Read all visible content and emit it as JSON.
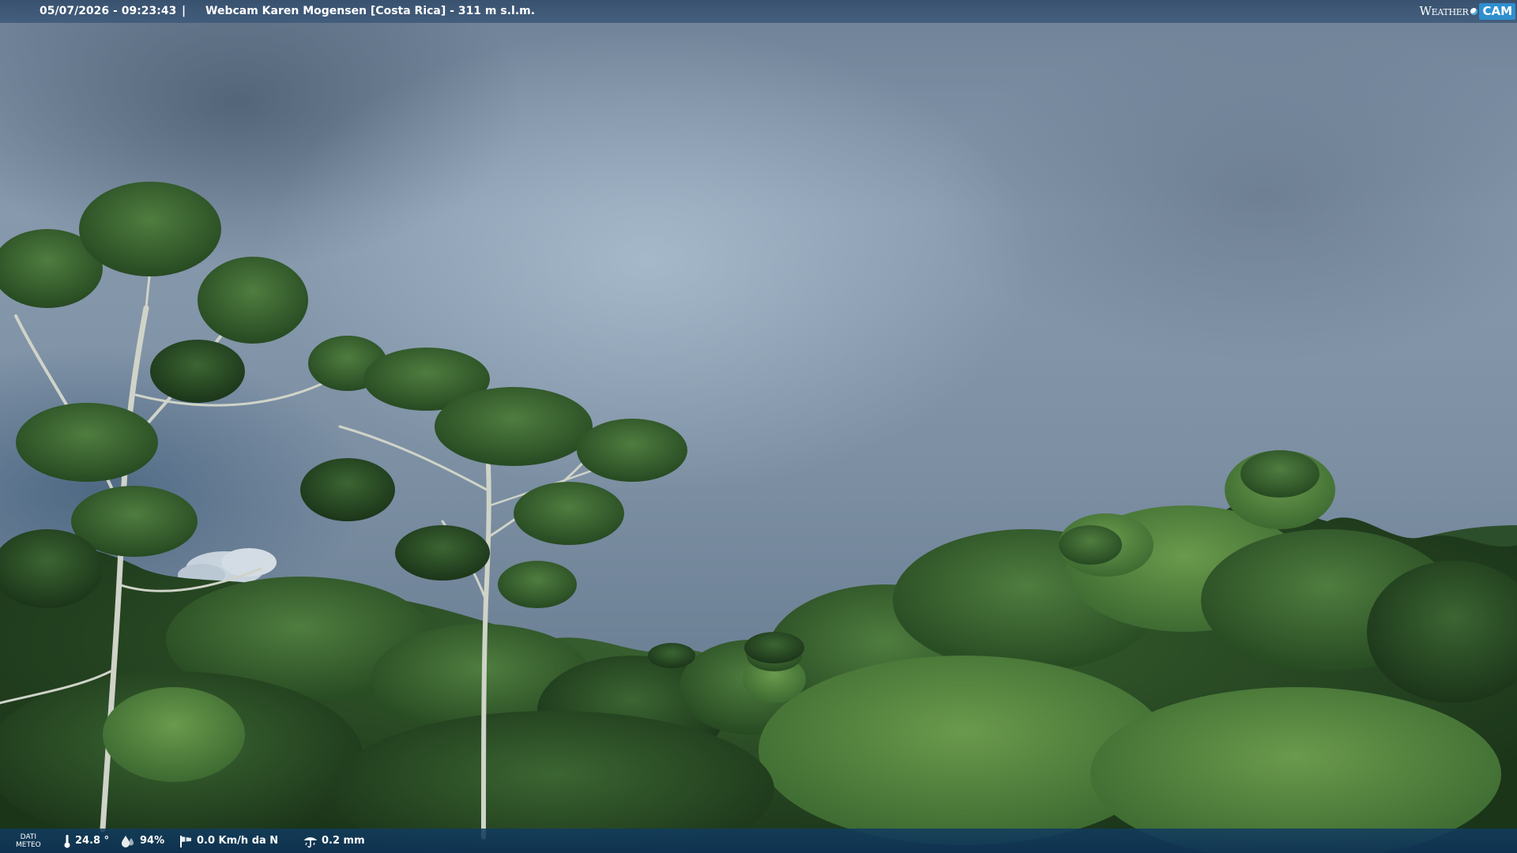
{
  "top_bar": {
    "timestamp": "05/07/2026 - 09:23:43",
    "separator": "|",
    "title": "Webcam Karen Mogensen [Costa Rica]  - 311 m s.l.m.",
    "logo": {
      "weather": "Weather",
      "cam": "CAM",
      "accent_color": "#2f8fcf"
    }
  },
  "bottom_bar": {
    "label_line1": "DATI",
    "label_line2": "METEO",
    "temperature": "24.8 °",
    "humidity": "94%",
    "wind": "0.0 Km/h da N",
    "rain": "0.2 mm",
    "icons": {
      "temperature": "thermometer-icon",
      "humidity": "humidity-drop-icon",
      "wind": "windsock-icon",
      "rain": "rain-gauge-icon"
    }
  },
  "scene": {
    "sky_color": "#7c8fa3",
    "foliage_color": "#2f5a2a"
  }
}
